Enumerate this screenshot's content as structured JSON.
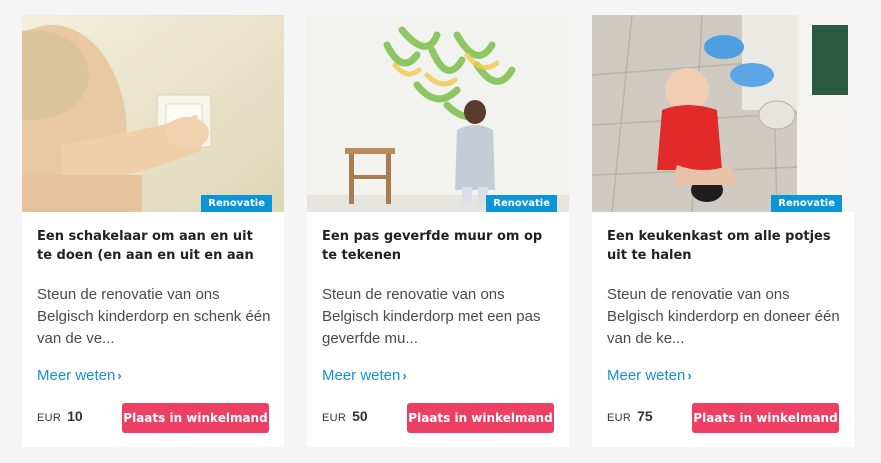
{
  "cards": [
    {
      "badge": "Renovatie",
      "title": "Een schakelaar om aan en uit te doen (en aan en uit en aan en uit en aan en uit)",
      "description": "Steun de renovatie van ons Belgisch kinderdorp en schenk één van de ve...",
      "more_label": "Meer weten",
      "currency": "EUR",
      "amount": "10",
      "cart_label": "Plaats in winkelmand"
    },
    {
      "badge": "Renovatie",
      "title": "Een pas geverfde muur om op te tekenen",
      "description": "Steun de renovatie van ons Belgisch kinderdorp met een pas geverfde mu...",
      "more_label": "Meer weten",
      "currency": "EUR",
      "amount": "50",
      "cart_label": "Plaats in winkelmand"
    },
    {
      "badge": "Renovatie",
      "title": "Een keukenkast om alle potjes uit te halen",
      "description": "Steun de renovatie van ons Belgisch kinderdorp en doneer één van de ke...",
      "more_label": "Meer weten",
      "currency": "EUR",
      "amount": "75",
      "cart_label": "Plaats in winkelmand"
    }
  ],
  "colors": {
    "badge": "#0a96d6",
    "link": "#1b8fd1",
    "button": "#ec3f63"
  },
  "icons": {
    "more_chevron": "chevron-right-icon"
  }
}
